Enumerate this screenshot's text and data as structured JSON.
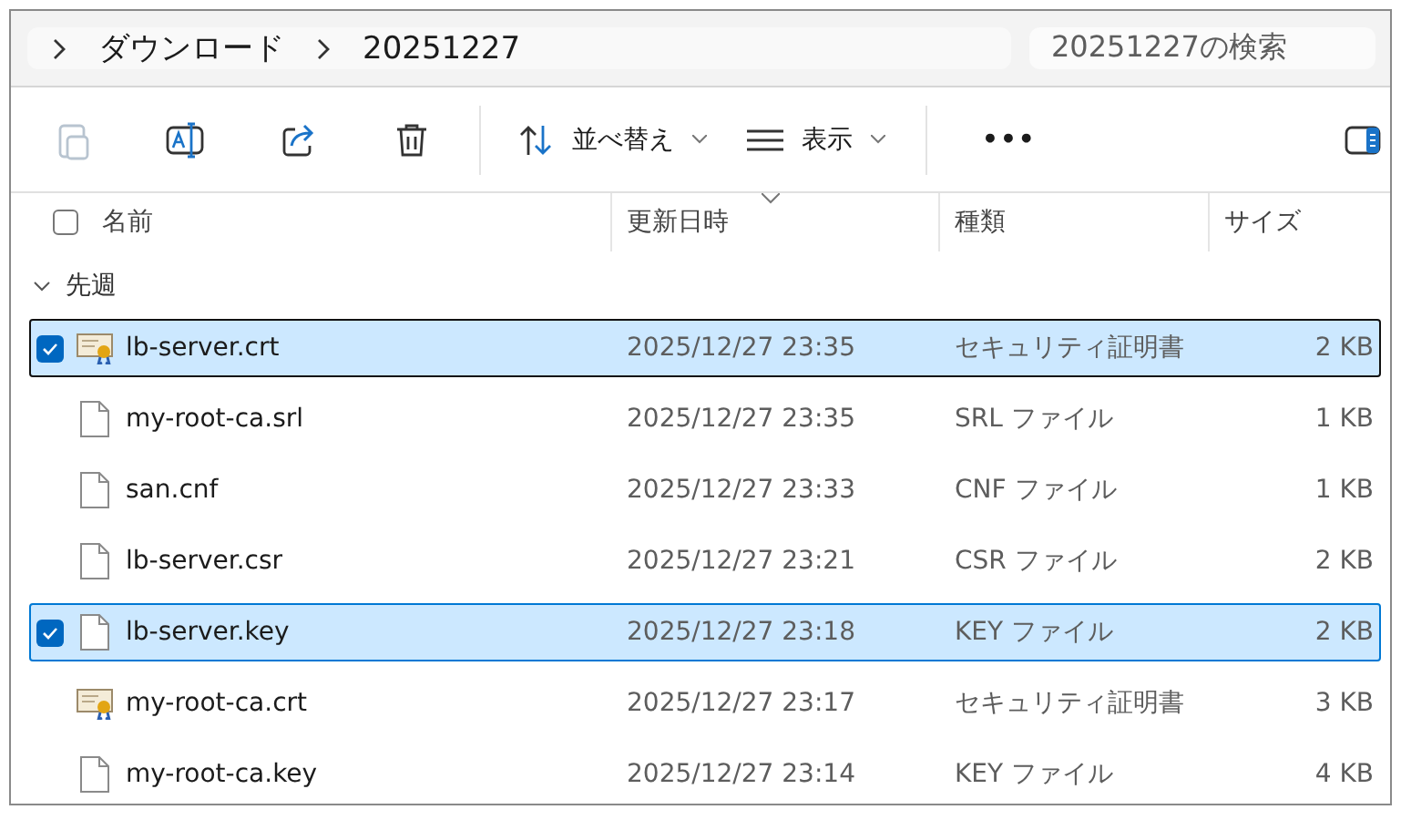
{
  "breadcrumb": [
    {
      "label": "ダウンロード"
    },
    {
      "label": "20251227"
    }
  ],
  "search": {
    "placeholder": "20251227の検索"
  },
  "toolbar": [
    {
      "kind": "paste",
      "disabled": true
    },
    {
      "kind": "rename",
      "disabled": false
    },
    {
      "kind": "share",
      "disabled": false
    },
    {
      "kind": "delete",
      "disabled": false
    },
    {
      "kind": "sort",
      "label": "並べ替え"
    },
    {
      "kind": "view",
      "label": "表示"
    },
    {
      "kind": "more",
      "label": "•••"
    }
  ],
  "select_all": {
    "checked": false
  },
  "columns": [
    {
      "label": "名前",
      "sorted": false
    },
    {
      "label": "更新日時",
      "sorted": true
    },
    {
      "label": "種類",
      "sorted": false
    },
    {
      "label": "サイズ",
      "sorted": false
    }
  ],
  "group": {
    "label": "先週",
    "expanded": true
  },
  "files": [
    {
      "name": "lb-server.crt",
      "modified": "2025/12/27 23:35",
      "type": "セキュリティ証明書",
      "size": "2 KB",
      "kind": "cert",
      "selected": true,
      "focused": true
    },
    {
      "name": "my-root-ca.srl",
      "modified": "2025/12/27 23:35",
      "type": "SRL ファイル",
      "size": "1 KB",
      "kind": "file",
      "selected": false,
      "focused": false
    },
    {
      "name": "san.cnf",
      "modified": "2025/12/27 23:33",
      "type": "CNF ファイル",
      "size": "1 KB",
      "kind": "file",
      "selected": false,
      "focused": false
    },
    {
      "name": "lb-server.csr",
      "modified": "2025/12/27 23:21",
      "type": "CSR ファイル",
      "size": "2 KB",
      "kind": "file",
      "selected": false,
      "focused": false
    },
    {
      "name": "lb-server.key",
      "modified": "2025/12/27 23:18",
      "type": "KEY ファイル",
      "size": "2 KB",
      "kind": "file",
      "selected": true,
      "focused": false
    },
    {
      "name": "my-root-ca.crt",
      "modified": "2025/12/27 23:17",
      "type": "セキュリティ証明書",
      "size": "3 KB",
      "kind": "cert",
      "selected": false,
      "focused": false
    },
    {
      "name": "my-root-ca.key",
      "modified": "2025/12/27 23:14",
      "type": "KEY ファイル",
      "size": "4 KB",
      "kind": "file",
      "selected": false,
      "focused": false
    }
  ]
}
